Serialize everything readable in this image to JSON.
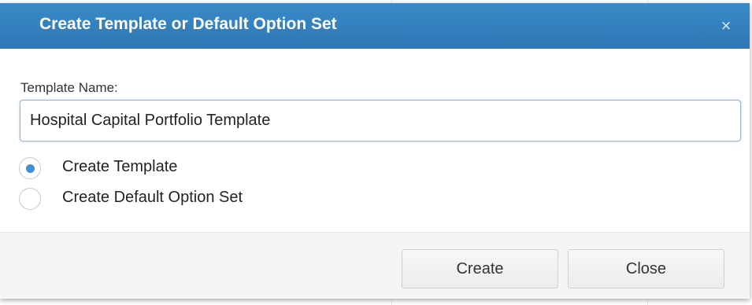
{
  "dialog": {
    "title": "Create Template or Default Option Set",
    "close_glyph": "×",
    "template_name_label": "Template Name:",
    "template_name_value": "Hospital Capital Portfolio Template",
    "options": [
      {
        "label": "Create Template",
        "selected": true
      },
      {
        "label": "Create Default Option Set",
        "selected": false
      }
    ],
    "buttons": {
      "create_label": "Create",
      "close_label": "Close"
    }
  },
  "colors": {
    "titlebar": "#2f7dbb",
    "radio_selected": "#3d8fd8",
    "input_border_focus": "#8fb8dc"
  }
}
